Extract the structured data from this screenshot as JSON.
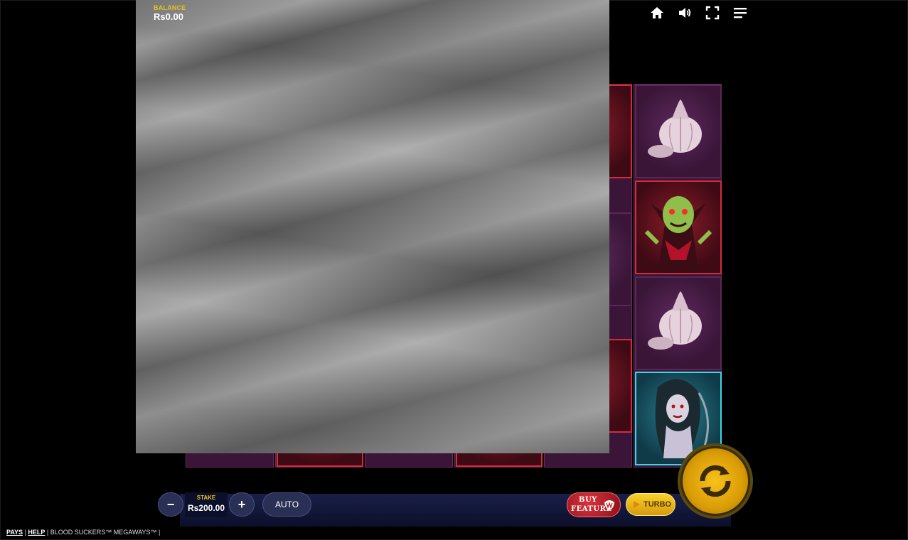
{
  "balance": {
    "label": "BALANCE",
    "value": "Rs0.00"
  },
  "top_bar": {
    "icons": [
      "home-icon",
      "sound-icon",
      "fullscreen-icon",
      "menu-icon"
    ]
  },
  "reels": {
    "symbols_right_column": [
      "garlic",
      "vampire-count",
      "garlic",
      "vampire-bride"
    ]
  },
  "controls": {
    "minus_label": "−",
    "plus_label": "+",
    "stake_label": "STAKE",
    "stake_value": "Rs200.00",
    "auto_label": "AUTO",
    "buy_feature_line1": "BUY",
    "buy_feature_line2": "FEATURE",
    "turbo_label": "TURBO"
  },
  "footer": {
    "pays": "PAYS",
    "help": "HELP",
    "game_title": "BLOOD SUCKERS™ MEGAWAYS™"
  },
  "colors": {
    "accent_gold": "#e8c21c",
    "reel_purple": "#3a1538",
    "reel_red": "#8d1c2a",
    "reel_teal": "#2a7e8e"
  }
}
